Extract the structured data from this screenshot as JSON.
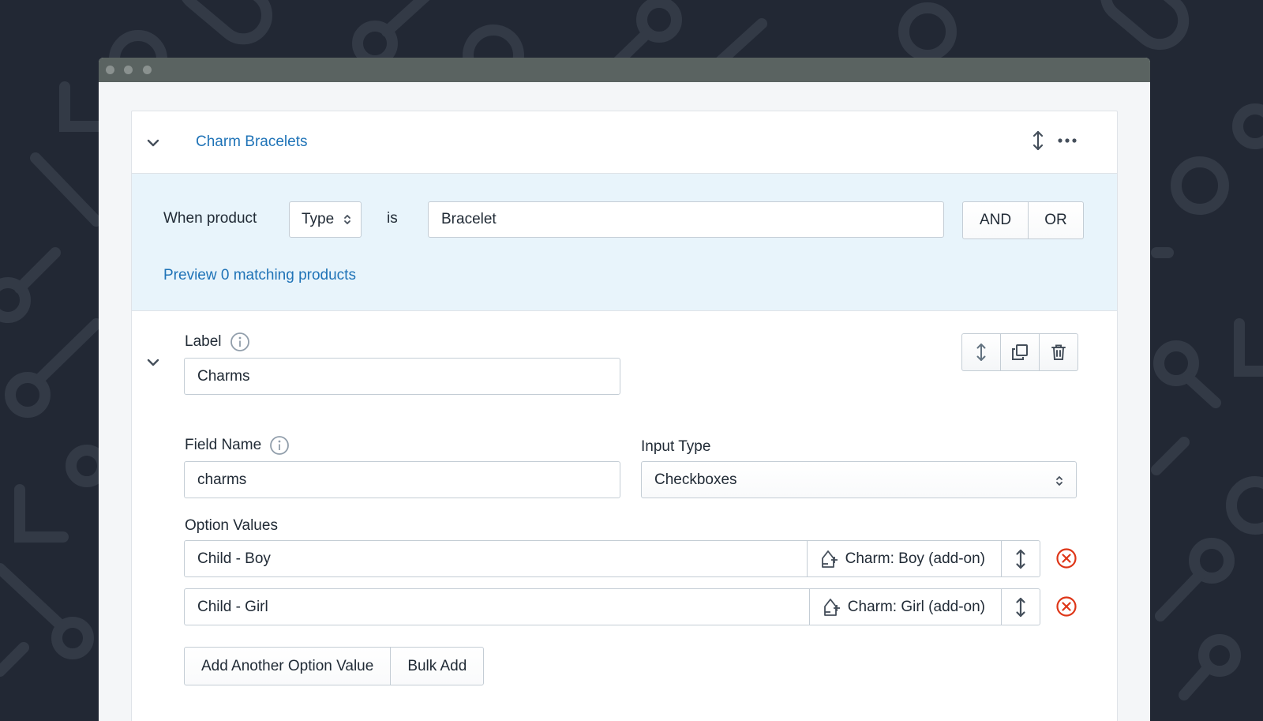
{
  "header": {
    "title": "Charm Bracelets",
    "icons": [
      "chevron-down-icon",
      "reorder-icon",
      "more-horizontal-icon"
    ]
  },
  "condition": {
    "prefix": "When product",
    "field_select": "Type",
    "operator": "is",
    "value": "Bracelet",
    "and_label": "AND",
    "or_label": "OR",
    "preview_link": "Preview 0 matching products"
  },
  "field": {
    "label_label": "Label",
    "label_value": "Charms",
    "field_name_label": "Field Name",
    "field_name_value": "charms",
    "input_type_label": "Input Type",
    "input_type_value": "Checkboxes",
    "option_values_label": "Option Values",
    "options": [
      {
        "value": "Child - Boy",
        "addon": "Charm: Boy (add-on)"
      },
      {
        "value": "Child - Girl",
        "addon": "Charm: Girl (add-on)"
      }
    ],
    "add_another_label": "Add Another Option Value",
    "bulk_add_label": "Bulk Add",
    "toolbar_icons": [
      "reorder-icon",
      "duplicate-icon",
      "trash-icon"
    ]
  },
  "colors": {
    "background": "#222834",
    "titlebar": "#5a6361",
    "link": "#1f73b7",
    "condition_bg": "#e8f4fb",
    "remove": "#de3618"
  }
}
